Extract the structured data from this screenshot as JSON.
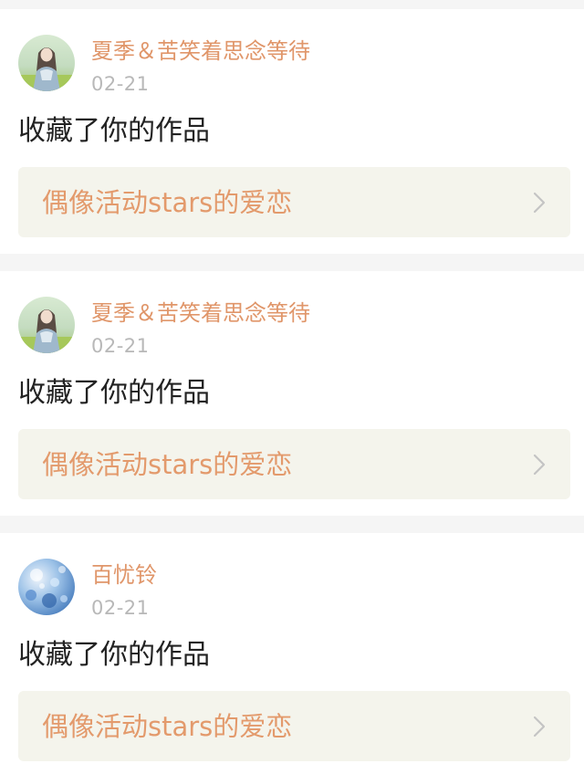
{
  "notifications": [
    {
      "username": "夏季＆苦笑着思念等待",
      "date": "02-21",
      "action": "收藏了你的作品",
      "work_title": "偶像活动stars的爱恋",
      "avatar_icon": "girl-portrait-avatar"
    },
    {
      "username": "夏季＆苦笑着思念等待",
      "date": "02-21",
      "action": "收藏了你的作品",
      "work_title": "偶像活动stars的爱恋",
      "avatar_icon": "girl-portrait-avatar"
    },
    {
      "username": "百忧铃",
      "date": "02-21",
      "action": "收藏了你的作品",
      "work_title": "偶像活动stars的爱恋",
      "avatar_icon": "blue-bokeh-avatar"
    }
  ],
  "colors": {
    "username": "#e0966a",
    "work_title": "#e39a6c",
    "date": "#b8b8b8",
    "action_text": "#222222",
    "link_background": "#f4f4ec",
    "page_background": "#f5f5f5"
  }
}
